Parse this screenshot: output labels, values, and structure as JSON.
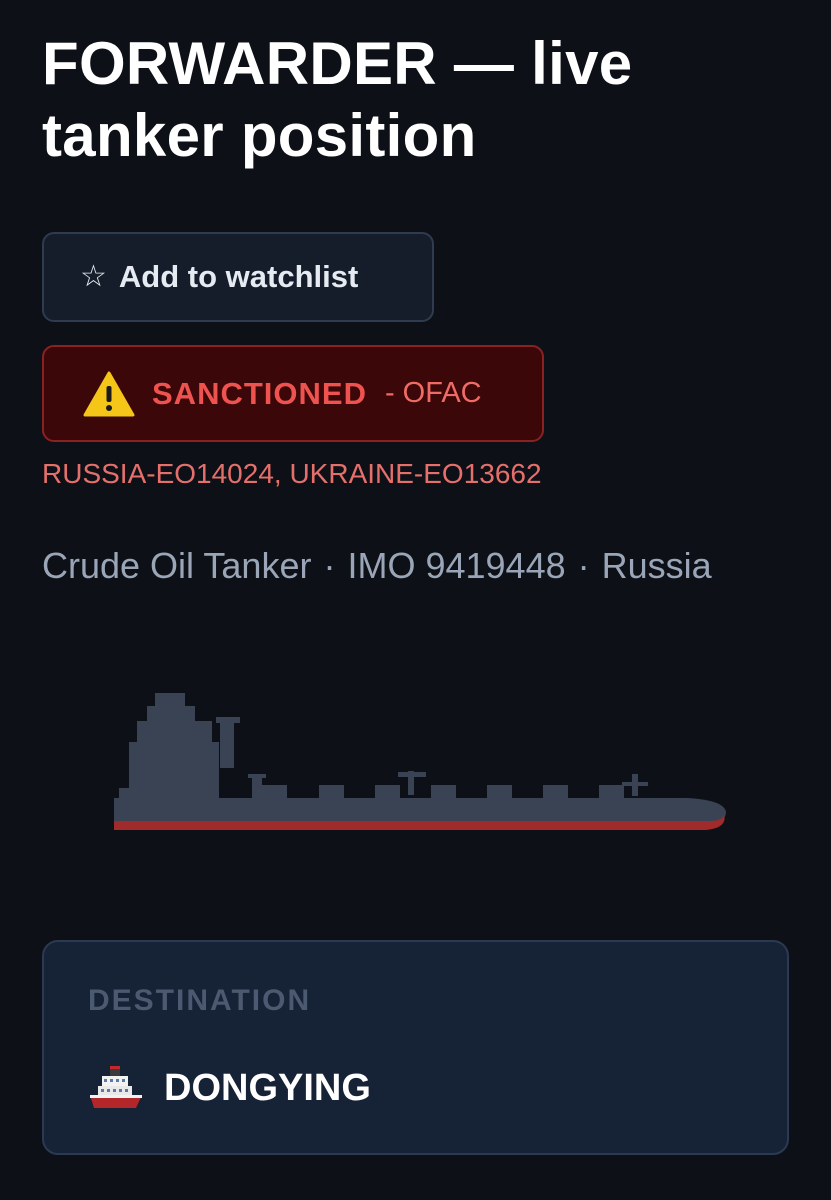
{
  "vessel": {
    "title": "FORWARDER — live tanker position",
    "type": "Crude Oil Tanker",
    "imo": "IMO 9419448",
    "flag": "Russia",
    "separator": "·"
  },
  "watchlist": {
    "icon": "star-outline-icon",
    "label": "Add to watchlist"
  },
  "sanction": {
    "icon": "warning-icon",
    "status": "SANCTIONED",
    "authority": "- OFAC",
    "programs": "RUSSIA-EO14024, UKRAINE-EO13662",
    "color": "#ef5350"
  },
  "destination": {
    "label": "DESTINATION",
    "icon": "ship-icon",
    "value": "DONGYING"
  },
  "colors": {
    "background": "#0d1117",
    "card": "#162235",
    "ship_silhouette": "#3a4354",
    "hull_stripe": "#a12a2a"
  }
}
